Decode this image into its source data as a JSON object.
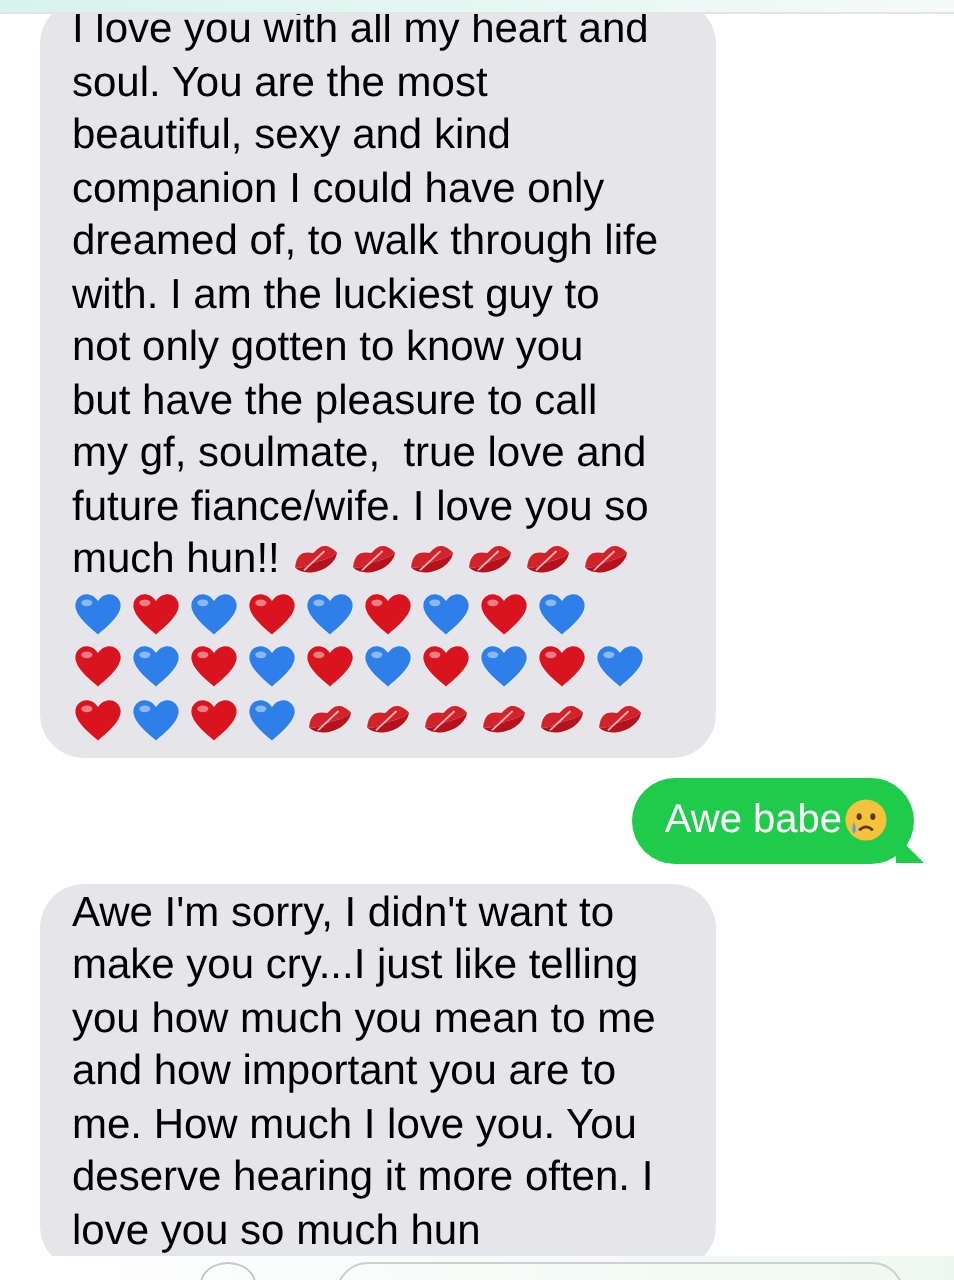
{
  "messages": [
    {
      "kind": "received",
      "lines": [
        "I love you with all my heart and",
        "soul. You are the most",
        "beautiful, sexy and kind",
        "companion I could have only",
        "dreamed of, to walk through life",
        "with. I am the luckiest guy to",
        "not only gotten to know you",
        "but have the pleasure to call",
        "my gf, soulmate,  true love and",
        "future fiance/wife. I love you so",
        "much hun!!"
      ],
      "emoji_rows": [
        [
          {
            "kind": "kiss"
          },
          {
            "kind": "kiss"
          },
          {
            "kind": "kiss"
          },
          {
            "kind": "kiss"
          },
          {
            "kind": "kiss"
          },
          {
            "kind": "kiss"
          }
        ],
        [
          {
            "kind": "blue_heart"
          },
          {
            "kind": "red_heart"
          },
          {
            "kind": "blue_heart"
          },
          {
            "kind": "red_heart"
          },
          {
            "kind": "blue_heart"
          },
          {
            "kind": "red_heart"
          },
          {
            "kind": "blue_heart"
          },
          {
            "kind": "red_heart"
          },
          {
            "kind": "blue_heart"
          }
        ],
        [
          {
            "kind": "red_heart"
          },
          {
            "kind": "blue_heart"
          },
          {
            "kind": "red_heart"
          },
          {
            "kind": "blue_heart"
          },
          {
            "kind": "red_heart"
          },
          {
            "kind": "blue_heart"
          },
          {
            "kind": "red_heart"
          },
          {
            "kind": "blue_heart"
          },
          {
            "kind": "red_heart"
          },
          {
            "kind": "blue_heart"
          }
        ],
        [
          {
            "kind": "red_heart"
          },
          {
            "kind": "blue_heart"
          },
          {
            "kind": "red_heart"
          },
          {
            "kind": "blue_heart"
          },
          {
            "kind": "kiss"
          },
          {
            "kind": "kiss"
          },
          {
            "kind": "kiss"
          },
          {
            "kind": "kiss"
          },
          {
            "kind": "kiss"
          },
          {
            "kind": "kiss"
          }
        ]
      ]
    },
    {
      "kind": "sent",
      "lines": [
        "Awe babe"
      ],
      "emoji_rows": [
        [
          {
            "kind": "crying_face"
          }
        ]
      ]
    },
    {
      "kind": "received",
      "lines": [
        "Awe I'm sorry, I didn't want to",
        "make you cry...I just like telling",
        "you how much you mean to me",
        "and how important you are to",
        "me. How much I love you. You",
        "deserve hearing it more often. I",
        "love you so much hun"
      ]
    }
  ]
}
